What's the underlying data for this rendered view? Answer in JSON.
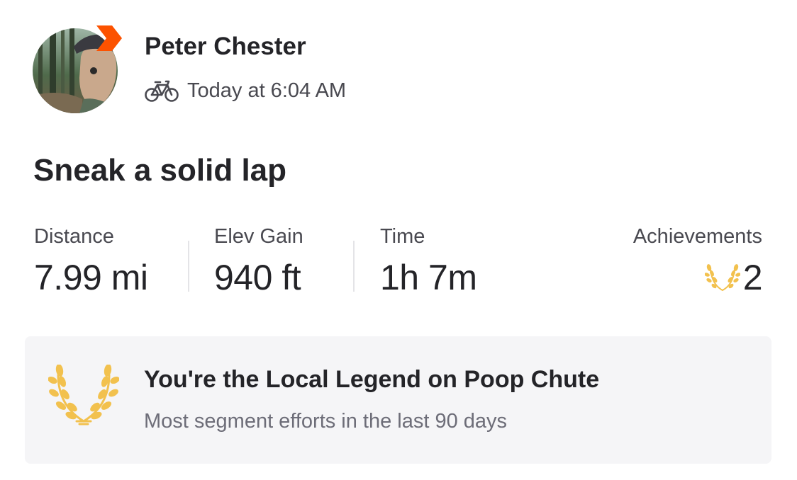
{
  "athlete": {
    "name": "Peter Chester",
    "avatar": "avatar-photo",
    "subscriber_badge": "chevron-badge-icon"
  },
  "activity": {
    "sport_icon": "bike-icon",
    "timestamp": "Today at 6:04 AM",
    "title": "Sneak a solid lap"
  },
  "stats": {
    "distance": {
      "label": "Distance",
      "value": "7.99 mi"
    },
    "elev_gain": {
      "label": "Elev Gain",
      "value": "940 ft"
    },
    "time": {
      "label": "Time",
      "value": "1h 7m"
    },
    "achievements": {
      "label": "Achievements",
      "value": "2",
      "icon": "laurel-icon"
    }
  },
  "local_legend": {
    "icon": "laurel-wreath-icon",
    "title": "You're the Local Legend on Poop Chute",
    "subtitle": "Most segment efforts in the last 90 days"
  },
  "colors": {
    "brand_orange": "#FC5200",
    "gold": "#F2C14E",
    "card_bg": "#F5F5F7",
    "text_primary": "#242428",
    "text_secondary": "#494950"
  }
}
